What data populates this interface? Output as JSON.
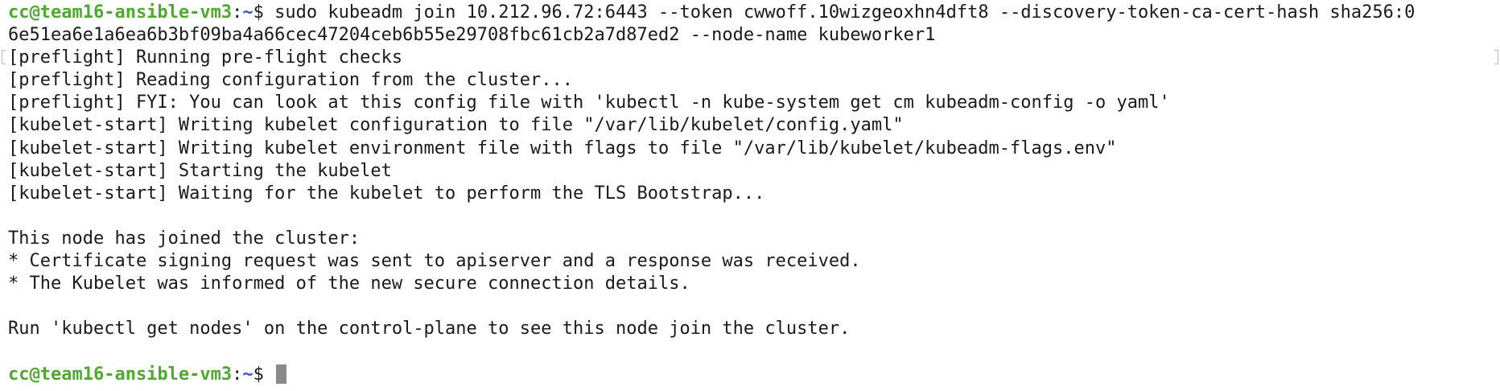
{
  "prompt": {
    "user_host": "cc@team16-ansible-vm3",
    "separator": ":",
    "path": "~",
    "symbol": "$ "
  },
  "command": {
    "line1": "sudo kubeadm join 10.212.96.72:6443 --token cwwoff.10wizgeoxhn4dft8 --discovery-token-ca-cert-hash sha256:0",
    "line2": "6e51ea6e1a6ea6b3bf09ba4a66cec47204ceb6b55e29708fbc61cb2a7d87ed2 --node-name kubeworker1"
  },
  "output": [
    "[preflight] Running pre-flight checks",
    "[preflight] Reading configuration from the cluster...",
    "[preflight] FYI: You can look at this config file with 'kubectl -n kube-system get cm kubeadm-config -o yaml'",
    "[kubelet-start] Writing kubelet configuration to file \"/var/lib/kubelet/config.yaml\"",
    "[kubelet-start] Writing kubelet environment file with flags to file \"/var/lib/kubelet/kubeadm-flags.env\"",
    "[kubelet-start] Starting the kubelet",
    "[kubelet-start] Waiting for the kubelet to perform the TLS Bootstrap...",
    "",
    "This node has joined the cluster:",
    "* Certificate signing request was sent to apiserver and a response was received.",
    "* The Kubelet was informed of the new secure connection details.",
    "",
    "Run 'kubectl get nodes' on the control-plane to see this node join the cluster.",
    ""
  ],
  "colors": {
    "background": "#ffffff",
    "text": "#1a1a1a",
    "prompt_user": "#4fa92f",
    "prompt_path": "#3b4fd0",
    "cursor": "#8a8a8a"
  }
}
